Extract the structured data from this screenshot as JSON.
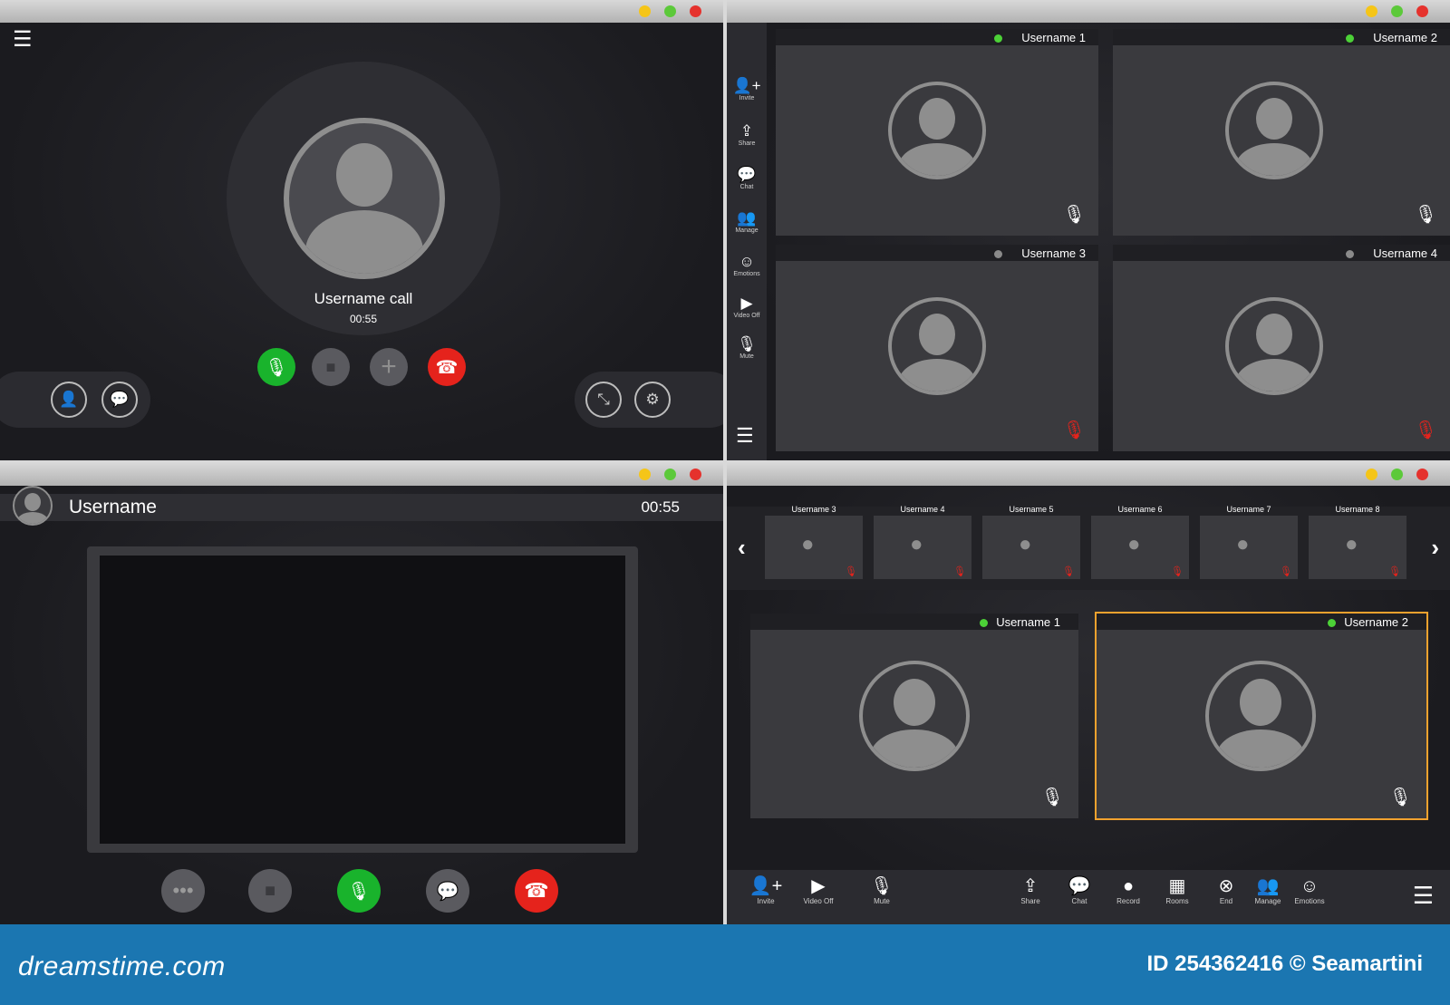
{
  "colors": {
    "accent_green": "#19b32c",
    "end_red": "#e5231c",
    "highlight": "#f2a22e",
    "footer_blue": "#1b76b1"
  },
  "panel1": {
    "caller_name": "Username call",
    "call_time": "00:55",
    "icons": [
      "menu-icon",
      "mic-icon",
      "video-camera-icon",
      "plus-icon",
      "phone-hangup-icon",
      "add-user-icon",
      "chat-icon",
      "minimize-icon",
      "settings-icon"
    ]
  },
  "panel2": {
    "sidebar": [
      {
        "label": "Invite",
        "icon": "👤+"
      },
      {
        "label": "Share",
        "icon": "⇪"
      },
      {
        "label": "Chat",
        "icon": "💬"
      },
      {
        "label": "Manage",
        "icon": "👥"
      },
      {
        "label": "Emotions",
        "icon": "☺"
      },
      {
        "label": "Video Off",
        "icon": "▶"
      },
      {
        "label": "Mute",
        "icon": "🎙"
      }
    ],
    "tiles": [
      {
        "name": "Username 1",
        "online": true,
        "muted": false
      },
      {
        "name": "Username 2",
        "online": true,
        "muted": false
      },
      {
        "name": "Username 3",
        "online": false,
        "muted": true
      },
      {
        "name": "Username 4",
        "online": false,
        "muted": true
      }
    ]
  },
  "panel3": {
    "username": "Username",
    "time": "00:55"
  },
  "panel4": {
    "thumbnails": [
      "Username 3",
      "Username 4",
      "Username 5",
      "Username 6",
      "Username 7",
      "Username 8"
    ],
    "tiles": [
      {
        "name": "Username 1",
        "online": true
      },
      {
        "name": "Username 2",
        "online": true
      }
    ],
    "toolbar": [
      {
        "label": "Invite",
        "icon": "👤+"
      },
      {
        "label": "Video Off",
        "icon": "▶"
      },
      {
        "label": "Mute",
        "icon": "🎙"
      },
      {
        "label": "Share",
        "icon": "⇪"
      },
      {
        "label": "Chat",
        "icon": "💬"
      },
      {
        "label": "Record",
        "icon": "●"
      },
      {
        "label": "Rooms",
        "icon": "▦"
      },
      {
        "label": "End",
        "icon": "⊗"
      },
      {
        "label": "Manage",
        "icon": "👥"
      },
      {
        "label": "Emotions",
        "icon": "☺"
      }
    ]
  },
  "footer": {
    "brand": "dreamstime.com",
    "credit": "ID 254362416 © Seamartini"
  }
}
